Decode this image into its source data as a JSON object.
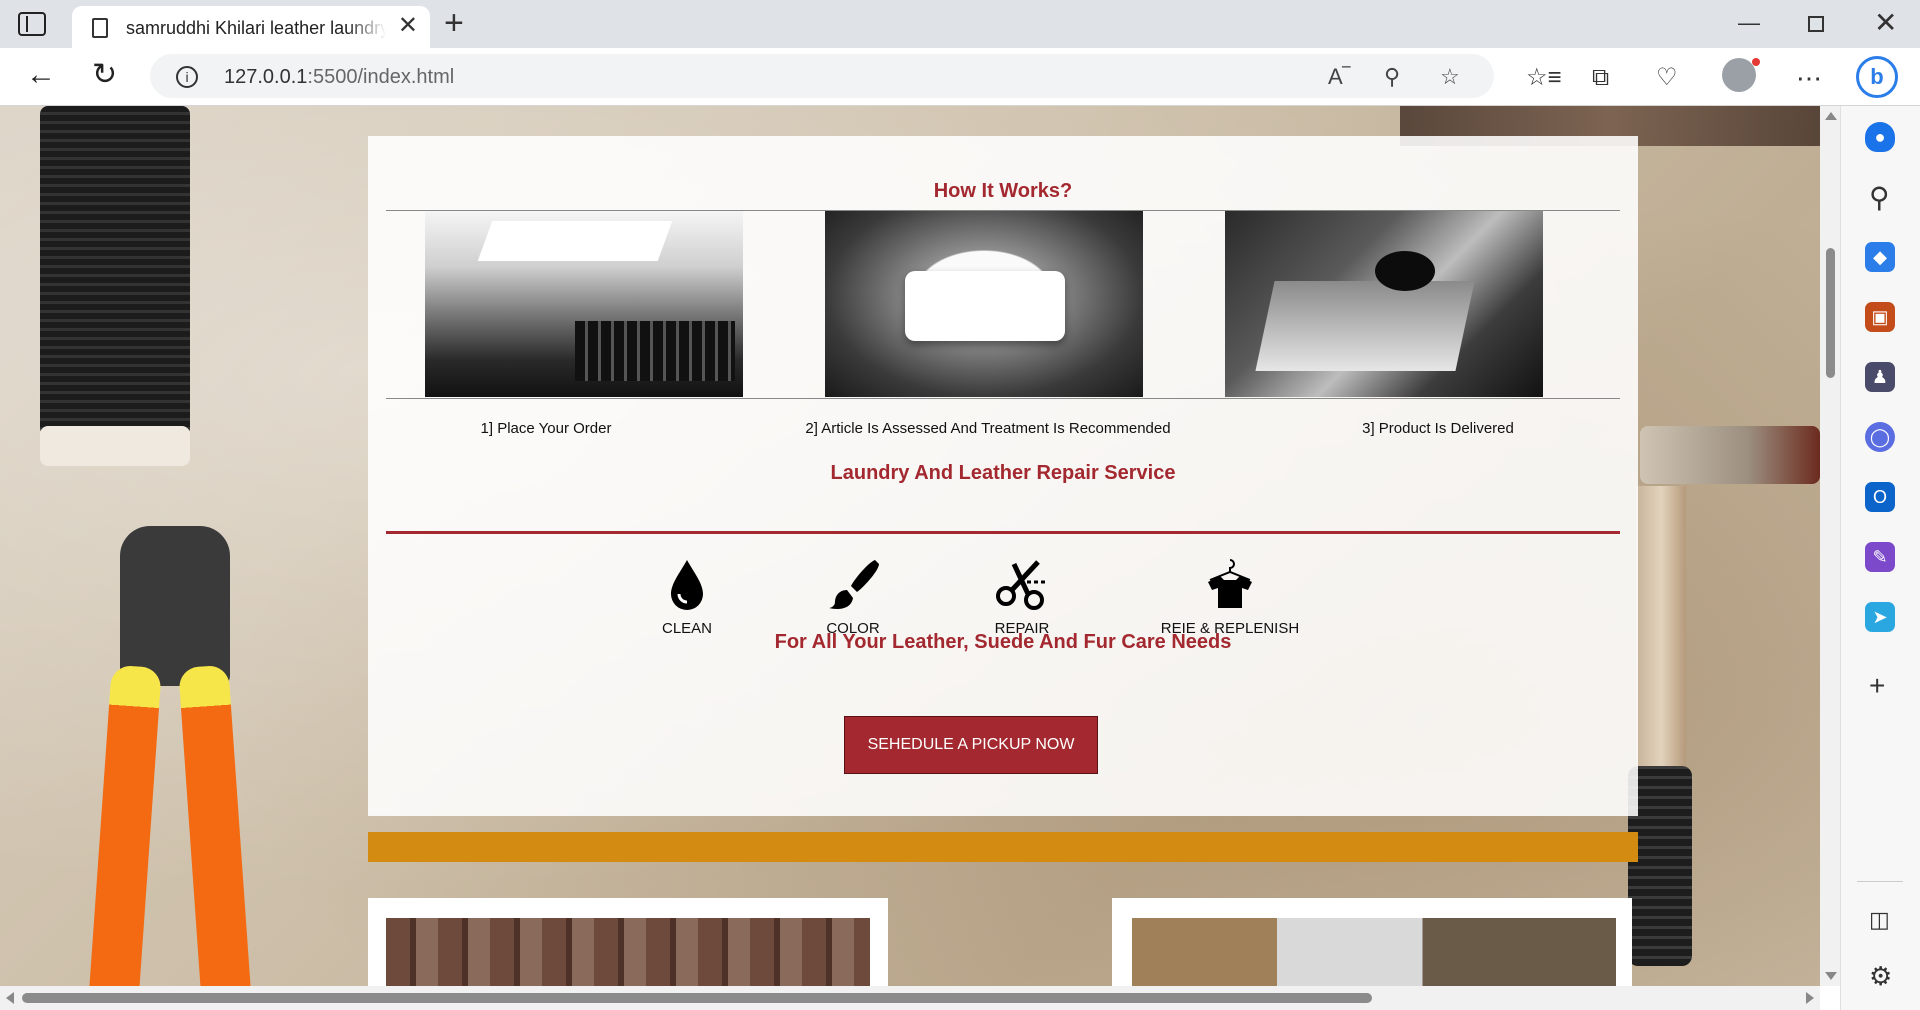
{
  "browser": {
    "tab_title": "samruddhi Khilari leather laundry",
    "tab_close": "✕",
    "new_tab": "+",
    "url_host": "127.0.0.1",
    "url_path": ":5500/index.html",
    "window_controls": {
      "minimize": "—",
      "close": "✕"
    }
  },
  "sections": {
    "how_it_works": "How It Works?",
    "steps": [
      {
        "label": "1] Place Your Order",
        "image": "typewriter-photo"
      },
      {
        "label": "2] Article Is Assessed And Treatment Is Recommended",
        "image": "handover-photo"
      },
      {
        "label": "3] Product Is Delivered",
        "image": "desk-laptop-photo"
      }
    ],
    "repair_title": "Laundry And Leather Repair Service",
    "services": [
      {
        "label": "CLEAN",
        "icon": "water-drop-icon"
      },
      {
        "label": "COLOR",
        "icon": "paintbrush-icon"
      },
      {
        "label": "REPAIR",
        "icon": "scissors-icon"
      },
      {
        "label": "REIE & REPLENISH",
        "icon": "shirt-hanger-icon"
      }
    ],
    "care_title": "For All Your Leather, Suede And Fur Care Needs",
    "pickup_button": "SEHEDULE A PICKUP NOW"
  },
  "colors": {
    "accent": "#a3282f",
    "gold_band": "#d38b12",
    "sidebar_bing": "#2b7de9"
  }
}
